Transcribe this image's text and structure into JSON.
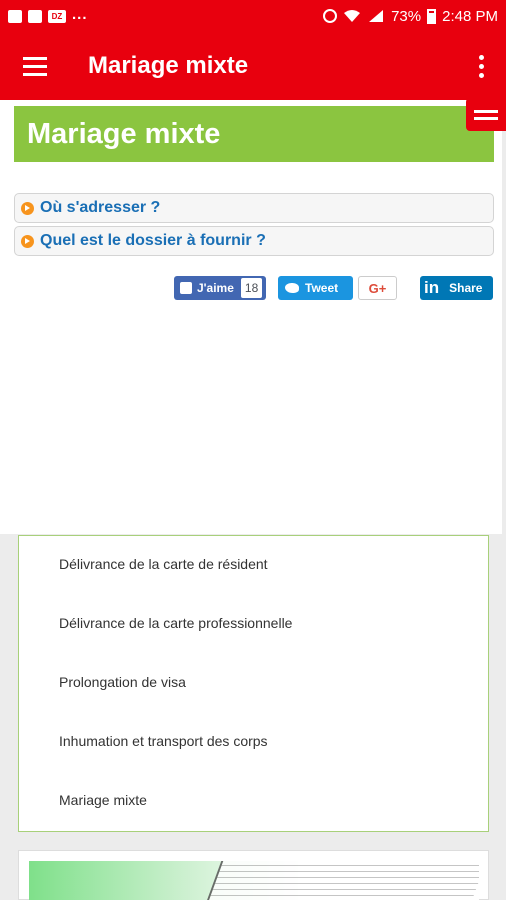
{
  "status_bar": {
    "battery": "73%",
    "time": "2:48 PM",
    "notification_icons": [
      "image-icon",
      "message-icon",
      "dz-app-icon"
    ],
    "more": "..."
  },
  "app_bar": {
    "title": "Mariage mixte"
  },
  "page": {
    "heading": "Mariage mixte",
    "accordions": [
      {
        "label": "Où s'adresser ?"
      },
      {
        "label": "Quel est le dossier à fournir ?"
      }
    ],
    "share": {
      "facebook_label": "J'aime",
      "facebook_count": "18",
      "twitter_label": "Tweet",
      "gplus_label": "G+",
      "linkedin_label": "Share",
      "linkedin_logo": "in"
    }
  },
  "related_links": [
    "Délivrance de la carte de résident",
    "Délivrance de la carte professionnelle",
    "Prolongation de visa",
    "Inhumation et transport des corps",
    "Mariage mixte"
  ],
  "colors": {
    "primary_red": "#e8000e",
    "banner_green": "#8bc540",
    "link_blue": "#1a6fb5",
    "bullet_orange": "#f7941d",
    "facebook": "#4267b2",
    "twitter": "#1b95e0",
    "linkedin": "#0077b5"
  }
}
